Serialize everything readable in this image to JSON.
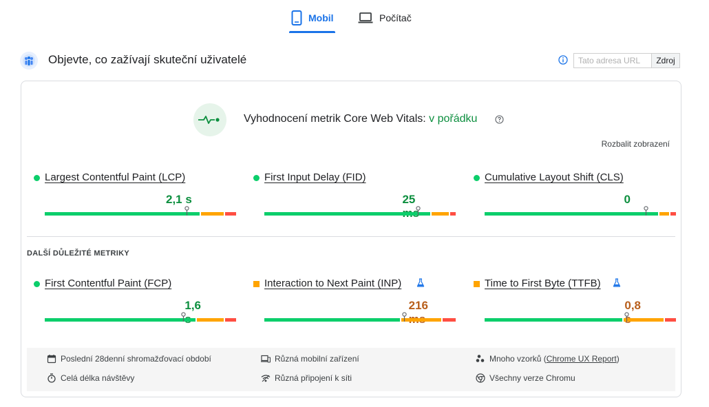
{
  "tabs": [
    {
      "label": "Mobil",
      "icon": "smartphone-icon",
      "active": true
    },
    {
      "label": "Počítač",
      "icon": "laptop-icon",
      "active": false
    }
  ],
  "header": {
    "title": "Objevte, co zažívají skuteční uživatelé",
    "url_placeholder": "Tato adresa URL",
    "source_button": "Zdroj"
  },
  "assessment": {
    "label": "Vyhodnocení metrik Core Web Vitals:",
    "status": "v pořádku",
    "expand_label": "Rozbalit zobrazení"
  },
  "core_metrics": [
    {
      "name": "Largest Contentful Paint (LCP)",
      "value": "2,1 s",
      "rating": "good",
      "bar": {
        "good": 0.82,
        "average": 0.12,
        "poor": 0.06
      },
      "position": 0.75
    },
    {
      "name": "First Input Delay (FID)",
      "value": "25 ms",
      "rating": "good",
      "bar": {
        "good": 0.88,
        "average": 0.09,
        "poor": 0.03
      },
      "position": 0.75
    },
    {
      "name": "Cumulative Layout Shift (CLS)",
      "value": "0",
      "rating": "good",
      "bar": {
        "good": 0.92,
        "average": 0.05,
        "poor": 0.03
      },
      "position": 0.75
    }
  ],
  "other_section_label": "DALŠÍ DŮLEŽITÉ METRIKY",
  "other_metrics": [
    {
      "name": "First Contentful Paint (FCP)",
      "value": "1,6 s",
      "rating": "good",
      "experimental": false,
      "bar": {
        "good": 0.8,
        "average": 0.14,
        "poor": 0.06
      },
      "position": 0.75
    },
    {
      "name": "Interaction to Next Paint (INP)",
      "value": "216 ms",
      "rating": "average",
      "experimental": true,
      "bar": {
        "good": 0.72,
        "average": 0.21,
        "poor": 0.07
      },
      "position": 0.75
    },
    {
      "name": "Time to First Byte (TTFB)",
      "value": "0,8 s",
      "rating": "average",
      "experimental": true,
      "bar": {
        "good": 0.73,
        "average": 0.21,
        "poor": 0.06
      },
      "position": 0.75
    }
  ],
  "footer": {
    "period": "Poslední 28denní shromažďovací období",
    "devices": "Různá mobilní zařízení",
    "samples_prefix": "Mnoho vzorků (",
    "samples_link": "Chrome UX Report",
    "samples_suffix": ")",
    "duration": "Celá délka návštěvy",
    "network": "Různá připojení k síti",
    "chrome": "Všechny verze Chromu"
  },
  "colors": {
    "accent": "#1a73e8",
    "good": "#0cce6b",
    "average": "#ffa400",
    "poor": "#ff4e42"
  }
}
